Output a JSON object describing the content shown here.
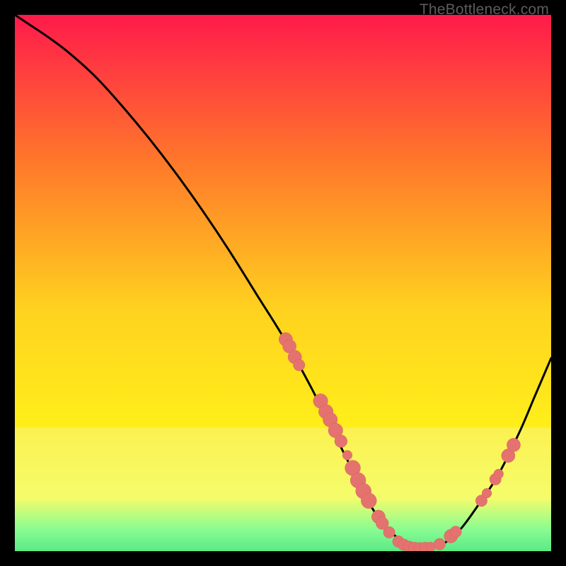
{
  "attribution": "TheBottleneck.com",
  "colors": {
    "grad_top": "#ff1a4b",
    "grad_mid1": "#ff7a2a",
    "grad_mid2": "#ffd21f",
    "grad_mid3": "#fff01a",
    "grad_bot1": "#f6ff40",
    "grad_bot2": "#4fff7a",
    "grad_bot3": "#07e36b",
    "curve": "#000000",
    "marker_fill": "#e4736f",
    "marker_stroke": "#d85e5a",
    "haze": "#f4f6bd"
  },
  "chart_data": {
    "type": "line",
    "title": "",
    "xlabel": "",
    "ylabel": "",
    "xlim": [
      0,
      100
    ],
    "ylim": [
      0,
      100
    ],
    "series": [
      {
        "name": "bottleneck-curve",
        "x": [
          0,
          3,
          6,
          10,
          15,
          20,
          25,
          30,
          35,
          40,
          45,
          50,
          55,
          58,
          60,
          62,
          65,
          68,
          72,
          76,
          80,
          83,
          86,
          90,
          94,
          97,
          100
        ],
        "y": [
          100,
          98,
          96,
          93,
          88.5,
          83,
          77,
          70.5,
          63.5,
          56,
          48,
          40,
          31,
          25,
          21,
          17,
          11,
          6,
          2,
          0.5,
          1.5,
          4,
          8,
          14,
          22,
          29,
          36
        ]
      }
    ],
    "markers": [
      {
        "x": 50.5,
        "y": 39.5,
        "r": 1.4
      },
      {
        "x": 51.2,
        "y": 38.2,
        "r": 1.4
      },
      {
        "x": 52.2,
        "y": 36.2,
        "r": 1.4
      },
      {
        "x": 53.0,
        "y": 34.7,
        "r": 1.2
      },
      {
        "x": 57.0,
        "y": 28.0,
        "r": 1.5
      },
      {
        "x": 58.0,
        "y": 26.0,
        "r": 1.5
      },
      {
        "x": 58.8,
        "y": 24.5,
        "r": 1.5
      },
      {
        "x": 59.8,
        "y": 22.5,
        "r": 1.5
      },
      {
        "x": 60.8,
        "y": 20.5,
        "r": 1.3
      },
      {
        "x": 62.0,
        "y": 17.9,
        "r": 1.0
      },
      {
        "x": 63.0,
        "y": 15.5,
        "r": 1.6
      },
      {
        "x": 64.0,
        "y": 13.2,
        "r": 1.6
      },
      {
        "x": 65.0,
        "y": 11.2,
        "r": 1.6
      },
      {
        "x": 66.0,
        "y": 9.4,
        "r": 1.6
      },
      {
        "x": 67.8,
        "y": 6.4,
        "r": 1.4
      },
      {
        "x": 68.5,
        "y": 5.2,
        "r": 1.3
      },
      {
        "x": 69.8,
        "y": 3.5,
        "r": 1.2
      },
      {
        "x": 71.5,
        "y": 1.8,
        "r": 1.2
      },
      {
        "x": 72.5,
        "y": 1.2,
        "r": 1.2
      },
      {
        "x": 73.5,
        "y": 0.8,
        "r": 1.2
      },
      {
        "x": 74.5,
        "y": 0.6,
        "r": 1.2
      },
      {
        "x": 75.5,
        "y": 0.55,
        "r": 1.2
      },
      {
        "x": 76.5,
        "y": 0.6,
        "r": 1.2
      },
      {
        "x": 77.5,
        "y": 0.8,
        "r": 1.0
      },
      {
        "x": 79.2,
        "y": 1.3,
        "r": 1.2
      },
      {
        "x": 81.3,
        "y": 2.8,
        "r": 1.4
      },
      {
        "x": 82.2,
        "y": 3.6,
        "r": 1.2
      },
      {
        "x": 87.0,
        "y": 9.4,
        "r": 1.2
      },
      {
        "x": 88.0,
        "y": 10.8,
        "r": 1.0
      },
      {
        "x": 89.6,
        "y": 13.4,
        "r": 1.2
      },
      {
        "x": 90.2,
        "y": 14.4,
        "r": 1.0
      },
      {
        "x": 92.0,
        "y": 17.8,
        "r": 1.4
      },
      {
        "x": 93.0,
        "y": 19.8,
        "r": 1.4
      }
    ],
    "haze_band": {
      "y_top": 23,
      "y_bottom": 0
    }
  }
}
